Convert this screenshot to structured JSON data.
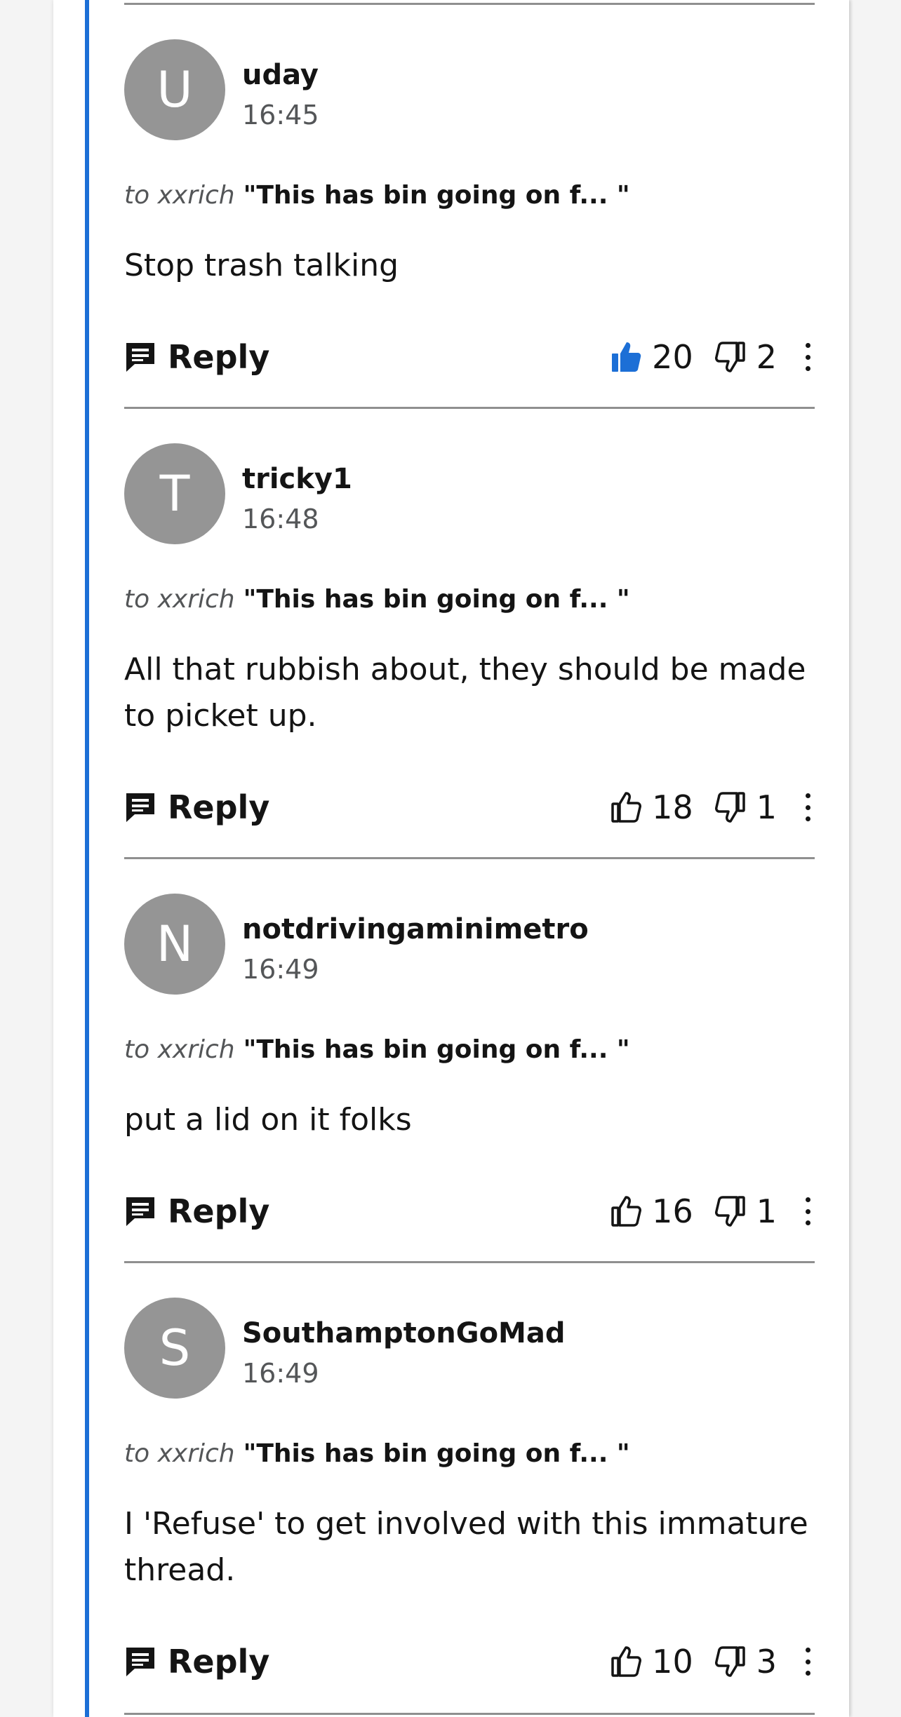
{
  "comments": [
    {
      "initial": "U",
      "username": "uday",
      "time": "16:45",
      "to_prefix": "to xxrich",
      "quote": "\"This has bin going on f... \"",
      "body": "Stop trash talking",
      "reply_label": "Reply",
      "likes": "20",
      "dislikes": "2",
      "liked": true
    },
    {
      "initial": "T",
      "username": "tricky1",
      "time": "16:48",
      "to_prefix": "to xxrich",
      "quote": "\"This has bin going on f... \"",
      "body": "All that rubbish about, they should be made to picket up.",
      "reply_label": "Reply",
      "likes": "18",
      "dislikes": "1",
      "liked": false
    },
    {
      "initial": "N",
      "username": "notdrivingaminimetro",
      "time": "16:49",
      "to_prefix": "to xxrich",
      "quote": "\"This has bin going on f... \"",
      "body": "put a lid on it folks",
      "reply_label": "Reply",
      "likes": "16",
      "dislikes": "1",
      "liked": false
    },
    {
      "initial": "S",
      "username": "SouthamptonGoMad",
      "time": "16:49",
      "to_prefix": "to xxrich",
      "quote": "\"This has bin going on f... \"",
      "body": "I 'Refuse' to get involved with this immature thread.",
      "reply_label": "Reply",
      "likes": "10",
      "dislikes": "3",
      "liked": false
    }
  ],
  "colors": {
    "thread_line": "#1c6fd6",
    "liked_icon": "#1c6fd6",
    "avatar": "#959595"
  },
  "icons": {
    "reply": "speech-bubble-icon",
    "like": "thumbs-up-icon",
    "dislike": "thumbs-down-icon",
    "more": "more-options-icon"
  }
}
